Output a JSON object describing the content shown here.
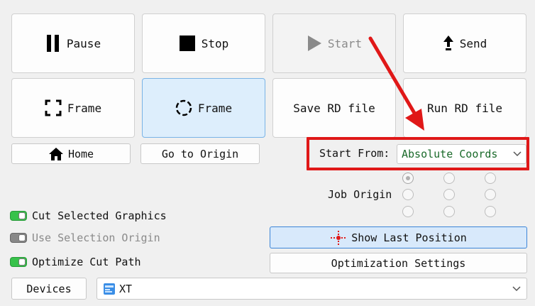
{
  "buttons": {
    "pause": "Pause",
    "stop": "Stop",
    "start": "Start",
    "send": "Send",
    "frame1": "Frame",
    "frame2": "Frame",
    "save_rd": "Save RD file",
    "run_rd": "Run RD file",
    "home": "Home",
    "go_origin": "Go to Origin",
    "show_last_position": "Show Last Position",
    "optimization_settings": "Optimization Settings",
    "devices": "Devices"
  },
  "start_from": {
    "label": "Start From:",
    "value": "Absolute Coords"
  },
  "job_origin": {
    "label": "Job Origin",
    "selected": "top-left"
  },
  "checks": [
    {
      "label": "Cut Selected Graphics",
      "on": true
    },
    {
      "label": "Use Selection Origin",
      "on": false
    },
    {
      "label": "Optimize Cut Path",
      "on": true
    }
  ],
  "device": {
    "name": "XT"
  },
  "colors": {
    "highlight_box": "#e01818",
    "arrow": "#e01818",
    "start_from_value": "#1a6a2a",
    "toggle_on": "#37c24a",
    "active_button": "#ddeefc"
  },
  "icons": {
    "pause": "pause-icon",
    "stop": "stop-icon",
    "start": "play-icon",
    "send": "upload-arrow-icon",
    "frame_square": "frame-square-icon",
    "frame_circle": "frame-circle-icon",
    "home": "home-icon",
    "crosshair": "crosshair-icon",
    "device": "device-icon",
    "dropdown": "chevron-down-icon"
  }
}
